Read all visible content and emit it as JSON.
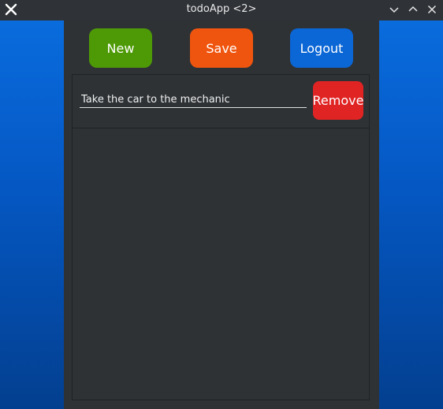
{
  "window": {
    "title": "todoApp <2>",
    "app_icon": "x-logo-icon",
    "controls": [
      "minimize-icon",
      "maximize-icon",
      "close-icon"
    ]
  },
  "toolbar": {
    "new_label": "New",
    "save_label": "Save",
    "logout_label": "Logout"
  },
  "todos": [
    {
      "text": "Take the car to the mechanic",
      "remove_label": "Remove"
    }
  ],
  "colors": {
    "new": "#4e9a06",
    "save": "#f0550f",
    "logout": "#0b66d6",
    "remove": "#e02424",
    "panel": "#2e3235",
    "background": "#0558c4"
  }
}
